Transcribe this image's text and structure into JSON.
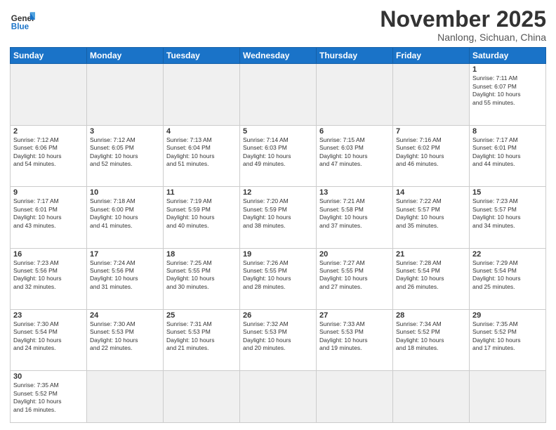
{
  "header": {
    "logo_general": "General",
    "logo_blue": "Blue",
    "month_title": "November 2025",
    "location": "Nanlong, Sichuan, China"
  },
  "weekdays": [
    "Sunday",
    "Monday",
    "Tuesday",
    "Wednesday",
    "Thursday",
    "Friday",
    "Saturday"
  ],
  "weeks": [
    [
      {
        "day": "",
        "info": "",
        "empty": true
      },
      {
        "day": "",
        "info": "",
        "empty": true
      },
      {
        "day": "",
        "info": "",
        "empty": true
      },
      {
        "day": "",
        "info": "",
        "empty": true
      },
      {
        "day": "",
        "info": "",
        "empty": true
      },
      {
        "day": "",
        "info": "",
        "empty": true
      },
      {
        "day": "1",
        "info": "Sunrise: 7:11 AM\nSunset: 6:07 PM\nDaylight: 10 hours\nand 55 minutes."
      }
    ],
    [
      {
        "day": "2",
        "info": "Sunrise: 7:12 AM\nSunset: 6:06 PM\nDaylight: 10 hours\nand 54 minutes."
      },
      {
        "day": "3",
        "info": "Sunrise: 7:12 AM\nSunset: 6:05 PM\nDaylight: 10 hours\nand 52 minutes."
      },
      {
        "day": "4",
        "info": "Sunrise: 7:13 AM\nSunset: 6:04 PM\nDaylight: 10 hours\nand 51 minutes."
      },
      {
        "day": "5",
        "info": "Sunrise: 7:14 AM\nSunset: 6:03 PM\nDaylight: 10 hours\nand 49 minutes."
      },
      {
        "day": "6",
        "info": "Sunrise: 7:15 AM\nSunset: 6:03 PM\nDaylight: 10 hours\nand 47 minutes."
      },
      {
        "day": "7",
        "info": "Sunrise: 7:16 AM\nSunset: 6:02 PM\nDaylight: 10 hours\nand 46 minutes."
      },
      {
        "day": "8",
        "info": "Sunrise: 7:17 AM\nSunset: 6:01 PM\nDaylight: 10 hours\nand 44 minutes."
      }
    ],
    [
      {
        "day": "9",
        "info": "Sunrise: 7:17 AM\nSunset: 6:01 PM\nDaylight: 10 hours\nand 43 minutes."
      },
      {
        "day": "10",
        "info": "Sunrise: 7:18 AM\nSunset: 6:00 PM\nDaylight: 10 hours\nand 41 minutes."
      },
      {
        "day": "11",
        "info": "Sunrise: 7:19 AM\nSunset: 5:59 PM\nDaylight: 10 hours\nand 40 minutes."
      },
      {
        "day": "12",
        "info": "Sunrise: 7:20 AM\nSunset: 5:59 PM\nDaylight: 10 hours\nand 38 minutes."
      },
      {
        "day": "13",
        "info": "Sunrise: 7:21 AM\nSunset: 5:58 PM\nDaylight: 10 hours\nand 37 minutes."
      },
      {
        "day": "14",
        "info": "Sunrise: 7:22 AM\nSunset: 5:57 PM\nDaylight: 10 hours\nand 35 minutes."
      },
      {
        "day": "15",
        "info": "Sunrise: 7:23 AM\nSunset: 5:57 PM\nDaylight: 10 hours\nand 34 minutes."
      }
    ],
    [
      {
        "day": "16",
        "info": "Sunrise: 7:23 AM\nSunset: 5:56 PM\nDaylight: 10 hours\nand 32 minutes."
      },
      {
        "day": "17",
        "info": "Sunrise: 7:24 AM\nSunset: 5:56 PM\nDaylight: 10 hours\nand 31 minutes."
      },
      {
        "day": "18",
        "info": "Sunrise: 7:25 AM\nSunset: 5:55 PM\nDaylight: 10 hours\nand 30 minutes."
      },
      {
        "day": "19",
        "info": "Sunrise: 7:26 AM\nSunset: 5:55 PM\nDaylight: 10 hours\nand 28 minutes."
      },
      {
        "day": "20",
        "info": "Sunrise: 7:27 AM\nSunset: 5:55 PM\nDaylight: 10 hours\nand 27 minutes."
      },
      {
        "day": "21",
        "info": "Sunrise: 7:28 AM\nSunset: 5:54 PM\nDaylight: 10 hours\nand 26 minutes."
      },
      {
        "day": "22",
        "info": "Sunrise: 7:29 AM\nSunset: 5:54 PM\nDaylight: 10 hours\nand 25 minutes."
      }
    ],
    [
      {
        "day": "23",
        "info": "Sunrise: 7:30 AM\nSunset: 5:54 PM\nDaylight: 10 hours\nand 24 minutes."
      },
      {
        "day": "24",
        "info": "Sunrise: 7:30 AM\nSunset: 5:53 PM\nDaylight: 10 hours\nand 22 minutes."
      },
      {
        "day": "25",
        "info": "Sunrise: 7:31 AM\nSunset: 5:53 PM\nDaylight: 10 hours\nand 21 minutes."
      },
      {
        "day": "26",
        "info": "Sunrise: 7:32 AM\nSunset: 5:53 PM\nDaylight: 10 hours\nand 20 minutes."
      },
      {
        "day": "27",
        "info": "Sunrise: 7:33 AM\nSunset: 5:53 PM\nDaylight: 10 hours\nand 19 minutes."
      },
      {
        "day": "28",
        "info": "Sunrise: 7:34 AM\nSunset: 5:52 PM\nDaylight: 10 hours\nand 18 minutes."
      },
      {
        "day": "29",
        "info": "Sunrise: 7:35 AM\nSunset: 5:52 PM\nDaylight: 10 hours\nand 17 minutes."
      }
    ],
    [
      {
        "day": "30",
        "info": "Sunrise: 7:35 AM\nSunset: 5:52 PM\nDaylight: 10 hours\nand 16 minutes.",
        "last": true
      },
      {
        "day": "",
        "info": "",
        "empty": true,
        "last": true
      },
      {
        "day": "",
        "info": "",
        "empty": true,
        "last": true
      },
      {
        "day": "",
        "info": "",
        "empty": true,
        "last": true
      },
      {
        "day": "",
        "info": "",
        "empty": true,
        "last": true
      },
      {
        "day": "",
        "info": "",
        "empty": true,
        "last": true
      },
      {
        "day": "",
        "info": "",
        "empty": true,
        "last": true
      }
    ]
  ]
}
